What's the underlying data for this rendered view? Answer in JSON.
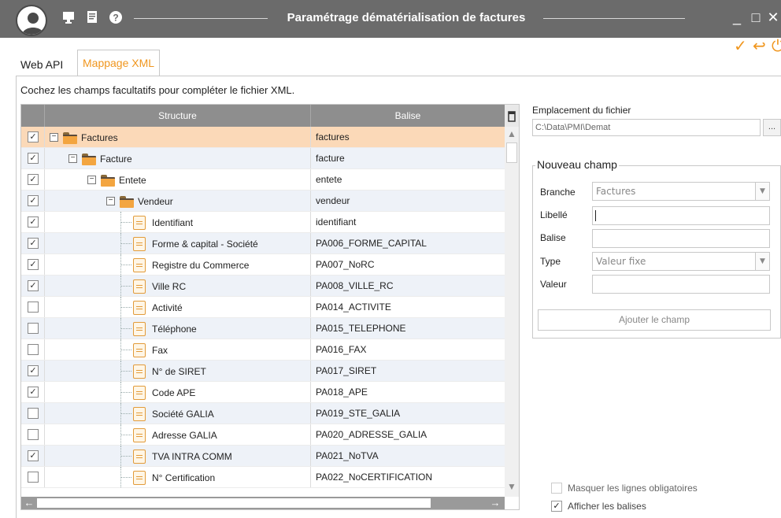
{
  "window": {
    "title": "Paramétrage dématérialisation de factures",
    "minimize_glyph": "_",
    "maximize_glyph": "□",
    "close_glyph": "✕"
  },
  "titlebar_icons": [
    "user-avatar-icon",
    "monitor-icon",
    "document-icon",
    "help-icon"
  ],
  "toolbar": {
    "validate_glyph": "✓",
    "undo_glyph": "↩",
    "power_glyph": "⏻",
    "accent_color": "#f0961e"
  },
  "tabs": [
    {
      "label": "Web API",
      "active": false
    },
    {
      "label": "Mappage XML",
      "active": true
    }
  ],
  "instruction": "Cochez les champs facultatifs pour compléter le fichier XML.",
  "grid": {
    "columns": [
      "Structure",
      "Balise"
    ],
    "rows": [
      {
        "checked": true,
        "label": "Factures",
        "balise": "factures",
        "kind": "folder",
        "level": 0,
        "selected": true
      },
      {
        "checked": true,
        "label": "Facture",
        "balise": "facture",
        "kind": "folder",
        "level": 1
      },
      {
        "checked": true,
        "label": "Entete",
        "balise": "entete",
        "kind": "folder",
        "level": 2
      },
      {
        "checked": true,
        "label": "Vendeur",
        "balise": "vendeur",
        "kind": "folder",
        "level": 3
      },
      {
        "checked": true,
        "label": "Identifiant",
        "balise": "identifiant",
        "kind": "file",
        "level": 4
      },
      {
        "checked": true,
        "label": "Forme & capital - Société",
        "balise": "PA006_FORME_CAPITAL",
        "kind": "file",
        "level": 4
      },
      {
        "checked": true,
        "label": "Registre du Commerce",
        "balise": "PA007_NoRC",
        "kind": "file",
        "level": 4
      },
      {
        "checked": true,
        "label": "Ville RC",
        "balise": "PA008_VILLE_RC",
        "kind": "file",
        "level": 4
      },
      {
        "checked": false,
        "label": "Activité",
        "balise": "PA014_ACTIVITE",
        "kind": "file",
        "level": 4
      },
      {
        "checked": false,
        "label": "Téléphone",
        "balise": "PA015_TELEPHONE",
        "kind": "file",
        "level": 4
      },
      {
        "checked": false,
        "label": "Fax",
        "balise": "PA016_FAX",
        "kind": "file",
        "level": 4
      },
      {
        "checked": true,
        "label": "N° de SIRET",
        "balise": "PA017_SIRET",
        "kind": "file",
        "level": 4
      },
      {
        "checked": true,
        "label": "Code APE",
        "balise": "PA018_APE",
        "kind": "file",
        "level": 4
      },
      {
        "checked": false,
        "label": "Société GALIA",
        "balise": "PA019_STE_GALIA",
        "kind": "file",
        "level": 4
      },
      {
        "checked": false,
        "label": "Adresse GALIA",
        "balise": "PA020_ADRESSE_GALIA",
        "kind": "file",
        "level": 4
      },
      {
        "checked": true,
        "label": "TVA INTRA COMM",
        "balise": "PA021_NoTVA",
        "kind": "file",
        "level": 4
      },
      {
        "checked": false,
        "label": "N° Certification",
        "balise": "PA022_NoCERTIFICATION",
        "kind": "file",
        "level": 4
      }
    ]
  },
  "file_location": {
    "label": "Emplacement du fichier",
    "value": "C:\\Data\\PMI\\Demat",
    "browse_label": "..."
  },
  "new_field": {
    "title": "Nouveau champ",
    "branche_label": "Branche",
    "branche_value": "Factures",
    "libelle_label": "Libellé",
    "libelle_value": "",
    "balise_label": "Balise",
    "balise_value": "",
    "type_label": "Type",
    "type_value": "Valeur fixe",
    "valeur_label": "Valeur",
    "valeur_value": "",
    "add_button": "Ajouter le champ"
  },
  "options": {
    "hide_mandatory": {
      "label": "Masquer les lignes obligatoires",
      "checked": false
    },
    "show_tags": {
      "label": "Afficher les balises",
      "checked": true
    }
  }
}
